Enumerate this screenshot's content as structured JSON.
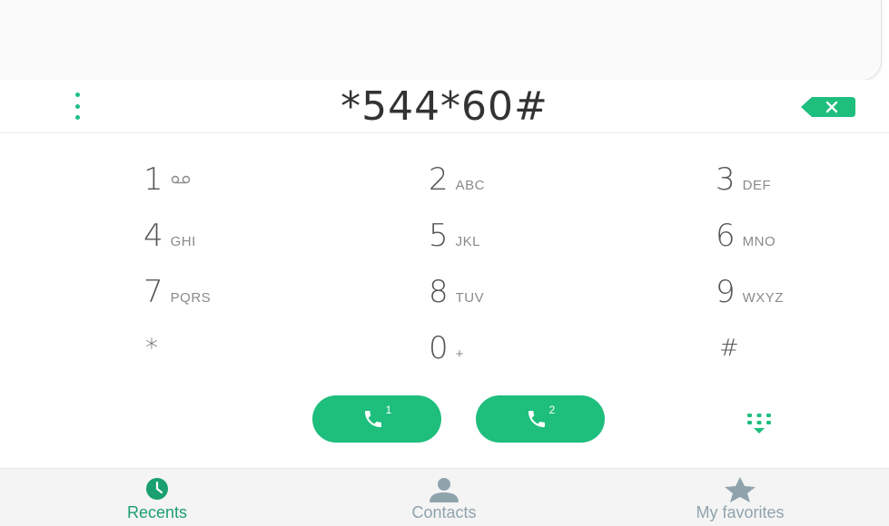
{
  "dialer": {
    "number": "*544*60#"
  },
  "keypad": {
    "keys": [
      {
        "digit": "1",
        "letters": ""
      },
      {
        "digit": "2",
        "letters": "ABC"
      },
      {
        "digit": "3",
        "letters": "DEF"
      },
      {
        "digit": "4",
        "letters": "GHI"
      },
      {
        "digit": "5",
        "letters": "JKL"
      },
      {
        "digit": "6",
        "letters": "MNO"
      },
      {
        "digit": "7",
        "letters": "PQRS"
      },
      {
        "digit": "8",
        "letters": "TUV"
      },
      {
        "digit": "9",
        "letters": "WXYZ"
      },
      {
        "digit": "*",
        "letters": ""
      },
      {
        "digit": "0",
        "letters": "+"
      },
      {
        "digit": "#",
        "letters": ""
      }
    ]
  },
  "call_buttons": {
    "sim1": "1",
    "sim2": "2"
  },
  "tabs": [
    {
      "label": "Recents",
      "icon": "clock-icon",
      "active": true
    },
    {
      "label": "Contacts",
      "icon": "person-icon",
      "active": false
    },
    {
      "label": "My favorites",
      "icon": "star-icon",
      "active": false
    }
  ],
  "colors": {
    "accent": "#1ebe7d",
    "tab_active": "#1a9f6e",
    "tab_inactive": "#8fa3ad"
  }
}
